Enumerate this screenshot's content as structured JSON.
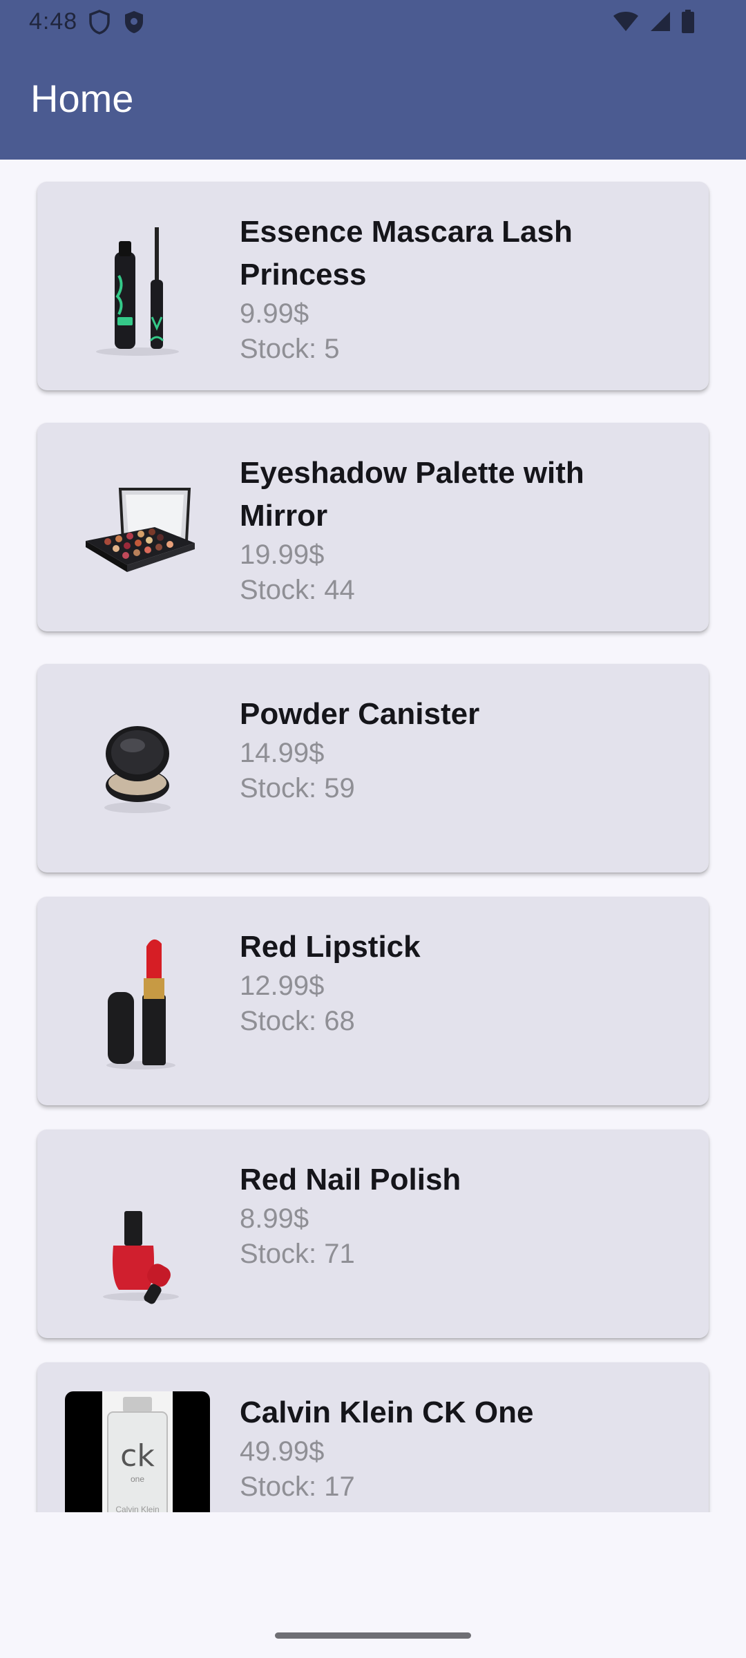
{
  "status_bar": {
    "time": "4:48",
    "left_icons": [
      "shield-outline-icon",
      "shield-filled-icon"
    ],
    "right_icons": [
      "wifi-icon",
      "cellular-signal-icon",
      "battery-icon"
    ]
  },
  "app_bar": {
    "title": "Home"
  },
  "products": [
    {
      "name": "Essence Mascara Lash Princess",
      "price": "9.99$",
      "stock": "Stock: 5",
      "image": "mascara"
    },
    {
      "name": "Eyeshadow Palette with Mirror",
      "price": "19.99$",
      "stock": "Stock: 44",
      "image": "eyeshadow-palette"
    },
    {
      "name": "Powder Canister",
      "price": "14.99$",
      "stock": "Stock: 59",
      "image": "powder-canister"
    },
    {
      "name": "Red Lipstick",
      "price": "12.99$",
      "stock": "Stock: 68",
      "image": "lipstick"
    },
    {
      "name": "Red Nail Polish",
      "price": "8.99$",
      "stock": "Stock: 71",
      "image": "nail-polish"
    },
    {
      "name": "Calvin Klein CK One",
      "price": "49.99$",
      "stock": "Stock: 17",
      "image": "perfume"
    }
  ],
  "perfume_label": {
    "logo": "ck",
    "subtitle": "one",
    "brand": "Calvin Klein"
  },
  "colors": {
    "app_bar": "#4b5b91",
    "background": "#f7f6fc",
    "card": "#e3e2ec",
    "price_text": "#8f8f95"
  }
}
